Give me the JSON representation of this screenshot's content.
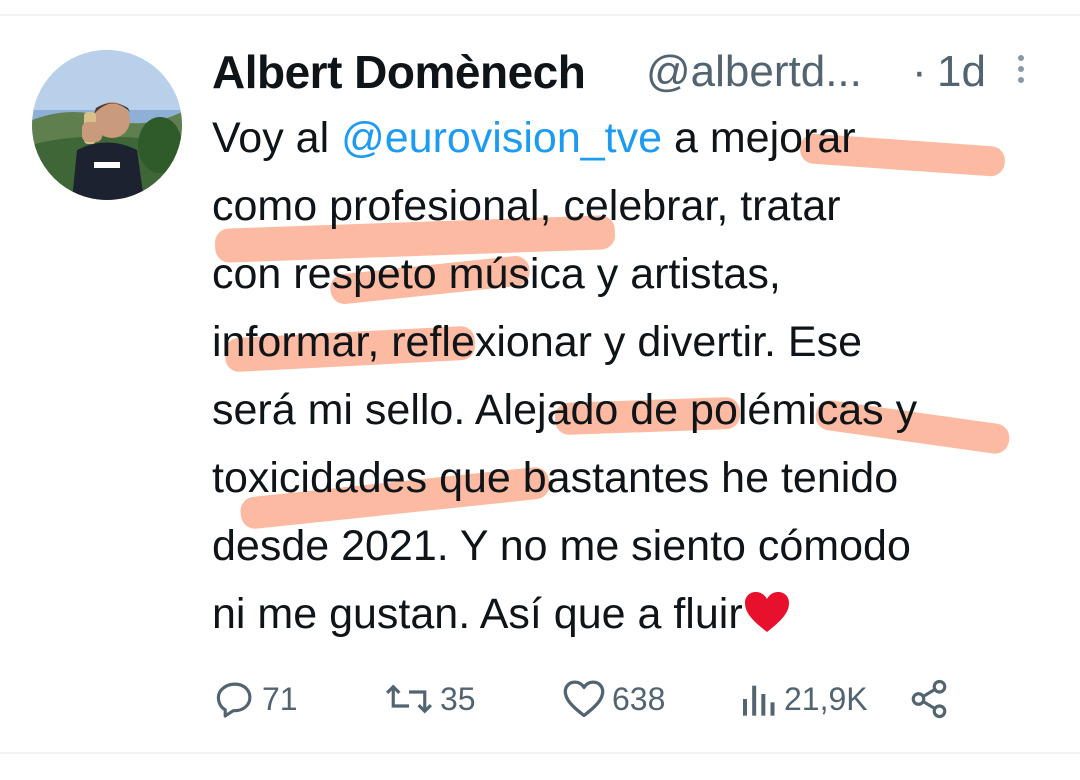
{
  "tweet": {
    "author_name": "Albert Domènech",
    "author_handle": "@albertd...",
    "separator": "·",
    "time": "1d",
    "text_parts": {
      "line1_a": "Voy al ",
      "line1_mention": "@eurovision_tve",
      "line1_b": " a mejorar",
      "line2": "como profesional, celebrar, tratar",
      "line3": "con respeto música y artistas,",
      "line4": "informar, reflexionar y divertir. Ese",
      "line5": "será mi sello. Alejado de polémicas y",
      "line6": "toxicidades que bastantes he tenido",
      "line7": "desde 2021. Y no me siento cómodo",
      "line8": "ni me gustan. Así que a fluir"
    },
    "emoji": "red-heart",
    "highlight_color": "#f88254"
  },
  "actions": {
    "replies": "71",
    "retweets": "35",
    "likes": "638",
    "views": "21,9K"
  },
  "colors": {
    "text": "#0f1419",
    "secondary": "#536471",
    "link": "#1d9bf0",
    "heart": "#e8112d"
  }
}
